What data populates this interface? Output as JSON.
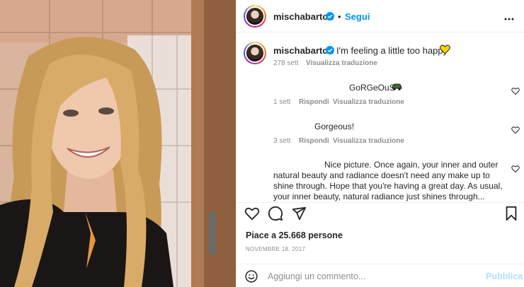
{
  "post": {
    "username": "mischabarton",
    "follow_label": "Segui",
    "dot": "•",
    "more_label": "•••"
  },
  "caption": {
    "username": "mischabarton",
    "text": "I'm feeling a little too happy",
    "emoji": "yellow-heart",
    "age": "278 sett",
    "translate": "Visualizza traduzione"
  },
  "comments": [
    {
      "text": "GoRGeOuS",
      "emoji": "green-car",
      "age": "1 sett",
      "reply": "Rispondi",
      "translate": "Visualizza traduzione"
    },
    {
      "text": "Gorgeous!",
      "age": "3 sett",
      "reply": "Rispondi",
      "translate": "Visualizza traduzione"
    },
    {
      "lines": [
        "Nice picture. Once again, your inner and outer",
        "natural beauty and radiance doesn't need any make up to",
        "shine through. Hope that you're having a great day. As usual,",
        "your inner beauty, natural radiance just shines through..."
      ]
    }
  ],
  "likes": "Piace a 25.668 persone",
  "date": "NOVEMBRE 18, 2017",
  "add_comment": {
    "placeholder": "Aggiungi un commento...",
    "publish": "Pubblica"
  },
  "colors": {
    "accent": "#0095f6",
    "muted": "#8e8e8e",
    "publish_disabled": "#b2dffc",
    "heart_emoji": "#f5d20a"
  },
  "icons": [
    "verified-icon",
    "more-icon",
    "heart-icon",
    "comment-icon",
    "share-icon",
    "bookmark-icon",
    "emoji-icon"
  ]
}
